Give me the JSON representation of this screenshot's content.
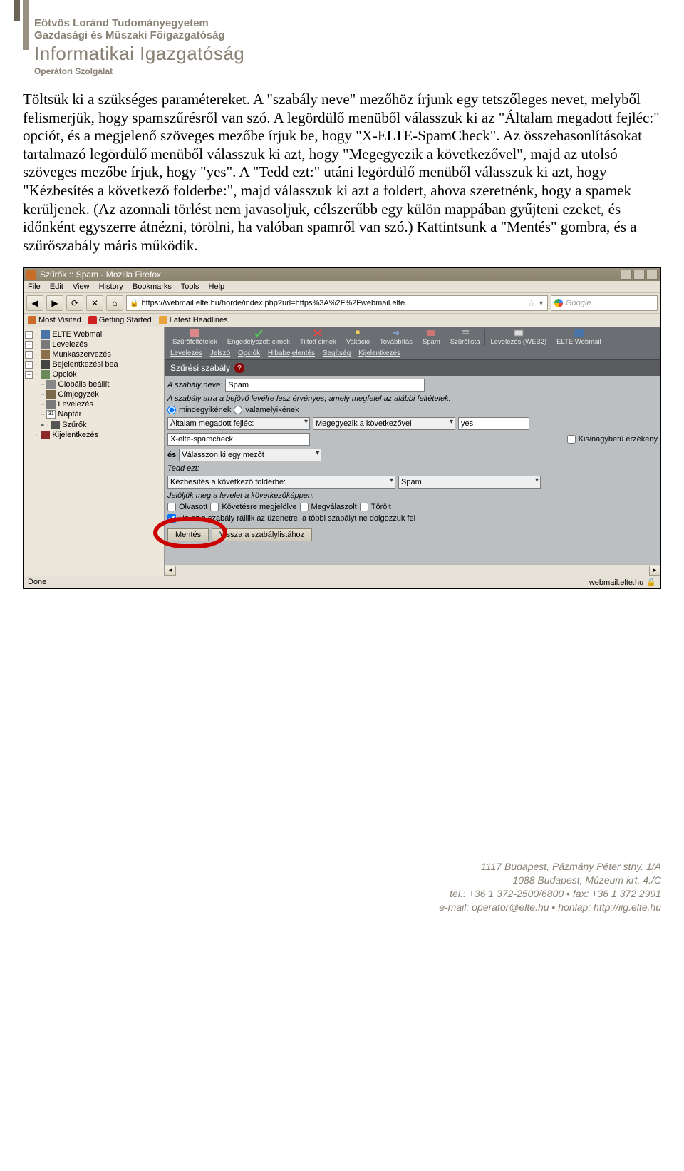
{
  "header": {
    "line1": "Eötvös Loránd Tudományegyetem",
    "line2": "Gazdasági és Műszaki Főigazgatóság",
    "line3": "Informatikai Igazgatóság",
    "line4": "Operátori Szolgálat"
  },
  "bodytext": "Töltsük ki a szükséges paramétereket. A \"szabály neve\" mezőhöz írjunk egy tetszőleges nevet, melyből felismerjük, hogy spamszűrésről van szó. A legördülő menüből válasszuk ki az \"Általam megadott fejléc:\" opciót, és a megjelenő szöveges mezőbe írjuk be, hogy \"X-ELTE-SpamCheck\". Az összehasonlításokat tartalmazó legördülő menüből válasszuk ki azt, hogy \"Megegyezik a következővel\", majd az utolsó szöveges mezőbe írjuk, hogy \"yes\". A \"Tedd ezt:\" utáni legördülő menüből válasszuk ki azt, hogy \"Kézbesítés a következő folderbe:\", majd válasszuk ki azt a foldert, ahova szeretnénk, hogy a spamek kerüljenek. (Az azonnali törlést nem javasoljuk, célszerűbb egy külön mappában gyűjteni ezeket, és időnként egyszerre átnézni, törölni, ha valóban spamről van szó.) Kattintsunk a \"Mentés\" gombra, és a szűrőszabály máris működik.",
  "firefox": {
    "title": "Szűrők :: Spam - Mozilla Firefox",
    "menu": [
      "File",
      "Edit",
      "View",
      "History",
      "Bookmarks",
      "Tools",
      "Help"
    ],
    "url": "https://webmail.elte.hu/horde/index.php?url=https%3A%2F%2Fwebmail.elte.",
    "search_placeholder": "Google",
    "bookmarks": {
      "most": "Most Visited",
      "start": "Getting Started",
      "head": "Latest Headlines"
    }
  },
  "appbar": [
    "Szűrőfeltételek",
    "Engedélyezett címek",
    "Tiltott címek",
    "Vakáció",
    "Továbbítás",
    "Spam",
    "Szűrőlista",
    "Levelezés (WEB2)",
    "ELTE Webmail"
  ],
  "appbar2": [
    "Levelezés",
    "Jelszó",
    "Opciók",
    "Hibabejelentés",
    "Segítség",
    "Kijelentkezés"
  ],
  "sidebar": {
    "items": [
      {
        "exp": "+",
        "label": "ELTE Webmail"
      },
      {
        "exp": "+",
        "label": "Levelezés"
      },
      {
        "exp": "+",
        "label": "Munkaszervezés"
      },
      {
        "exp": "+",
        "label": "Bejelentkezési bea"
      },
      {
        "exp": "-",
        "label": "Opciók",
        "children": [
          {
            "label": "Globális beállít"
          },
          {
            "label": "Címjegyzék"
          },
          {
            "label": "Levelezés"
          },
          {
            "label": "Naptár",
            "pre": "31"
          },
          {
            "label": "Szűrők",
            "arrow": true
          }
        ]
      },
      {
        "exp": "",
        "label": "Kijelentkezés"
      }
    ]
  },
  "rule": {
    "header": "Szűrési szabály",
    "name_label": "A szabály neve:",
    "name_value": "Spam",
    "desc": "A szabály arra a bejövő levélre lesz érvényes, amely megfelel az alábbi feltételek:",
    "radio_all": "mindegyikének",
    "radio_any": "valamelyikének",
    "field_select": "Általam megadott fejléc:",
    "compare_select": "Megegyezik a következővel",
    "compare_value": "yes",
    "header_value": "X-elte-spamcheck",
    "case_label": "Kis/nagybetű érzékeny",
    "and": "és",
    "field_select2": "Válasszon ki egy mezőt",
    "action_label": "Tedd ezt:",
    "action_select": "Kézbesítés a következő folderbe:",
    "action_folder": "Spam",
    "mark_label": "Jelöljük meg a levelet a következőképpen:",
    "mark_opts": [
      "Olvasott",
      "Követésre megjelölve",
      "Megválaszolt",
      "Törölt"
    ],
    "stop_label": "Ha ez a szabály ráillik az üzenetre, a többi szabályt ne dolgozzuk fel",
    "save": "Mentés",
    "back": "Vissza a szabálylistához"
  },
  "status": {
    "done": "Done",
    "host": "webmail.elte.hu"
  },
  "footer": {
    "l1": "1117 Budapest, Pázmány Péter stny. 1/A",
    "l2": "1088 Budapest, Múzeum krt. 4./C",
    "l3a": "tel.: +36 1 372-2500/6800",
    "l3b": "fax: +36 1 372 2991",
    "l4a": "e-mail: operator@elte.hu",
    "l4b": "honlap: http://iig.elte.hu"
  }
}
